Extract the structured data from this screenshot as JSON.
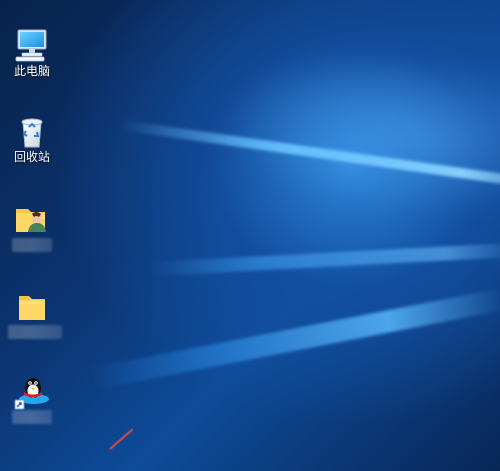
{
  "desktop": {
    "icons": [
      {
        "label": "此电脑",
        "icon": "this-pc-icon"
      },
      {
        "label": "回收站",
        "icon": "recycle-bin-icon"
      },
      {
        "label": "",
        "icon": "user-folder-icon"
      },
      {
        "label": "",
        "icon": "folder-icon"
      },
      {
        "label": "",
        "icon": "qq-icon"
      }
    ]
  },
  "colors": {
    "wallpaper_primary": "#0a2c5e",
    "wallpaper_highlight": "#57b8ff",
    "text": "#ffffff",
    "arrow": "#cc4343"
  }
}
